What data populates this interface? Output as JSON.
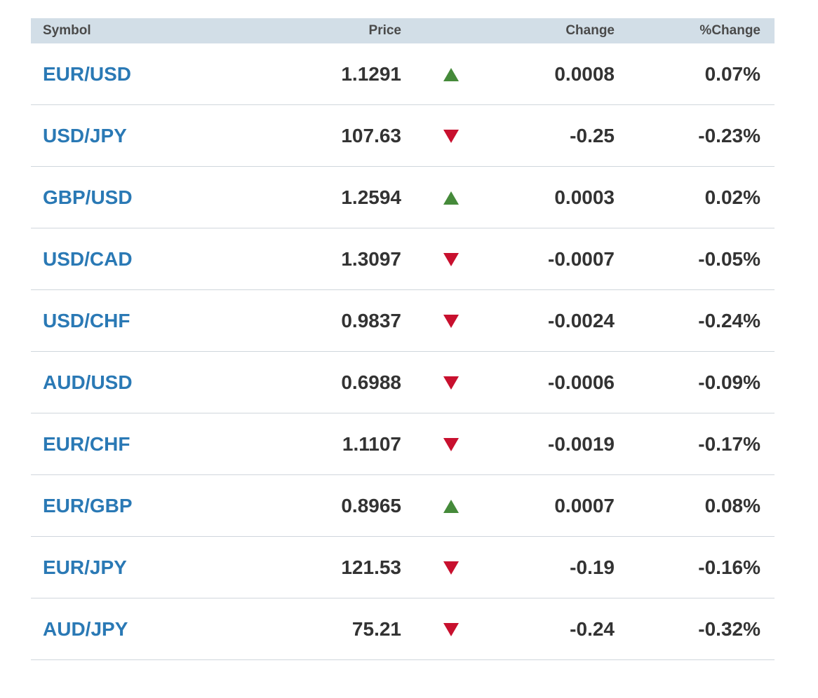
{
  "colors": {
    "header_bg": "#d2dee7",
    "symbol_link": "#2a79b5",
    "up": "#458a3a",
    "down": "#c8102e",
    "divider": "#d0d6dc"
  },
  "table": {
    "headers": {
      "symbol": "Symbol",
      "price": "Price",
      "change": "Change",
      "pct_change": "%Change"
    },
    "rows": [
      {
        "symbol": "EUR/USD",
        "price": "1.1291",
        "direction": "up",
        "direction_icon": "triangle-up-icon",
        "change": "0.0008",
        "pct_change": "0.07%"
      },
      {
        "symbol": "USD/JPY",
        "price": "107.63",
        "direction": "down",
        "direction_icon": "triangle-down-icon",
        "change": "-0.25",
        "pct_change": "-0.23%"
      },
      {
        "symbol": "GBP/USD",
        "price": "1.2594",
        "direction": "up",
        "direction_icon": "triangle-up-icon",
        "change": "0.0003",
        "pct_change": "0.02%"
      },
      {
        "symbol": "USD/CAD",
        "price": "1.3097",
        "direction": "down",
        "direction_icon": "triangle-down-icon",
        "change": "-0.0007",
        "pct_change": "-0.05%"
      },
      {
        "symbol": "USD/CHF",
        "price": "0.9837",
        "direction": "down",
        "direction_icon": "triangle-down-icon",
        "change": "-0.0024",
        "pct_change": "-0.24%"
      },
      {
        "symbol": "AUD/USD",
        "price": "0.6988",
        "direction": "down",
        "direction_icon": "triangle-down-icon",
        "change": "-0.0006",
        "pct_change": "-0.09%"
      },
      {
        "symbol": "EUR/CHF",
        "price": "1.1107",
        "direction": "down",
        "direction_icon": "triangle-down-icon",
        "change": "-0.0019",
        "pct_change": "-0.17%"
      },
      {
        "symbol": "EUR/GBP",
        "price": "0.8965",
        "direction": "up",
        "direction_icon": "triangle-up-icon",
        "change": "0.0007",
        "pct_change": "0.08%"
      },
      {
        "symbol": "EUR/JPY",
        "price": "121.53",
        "direction": "down",
        "direction_icon": "triangle-down-icon",
        "change": "-0.19",
        "pct_change": "-0.16%"
      },
      {
        "symbol": "AUD/JPY",
        "price": "75.21",
        "direction": "down",
        "direction_icon": "triangle-down-icon",
        "change": "-0.24",
        "pct_change": "-0.32%"
      }
    ]
  }
}
